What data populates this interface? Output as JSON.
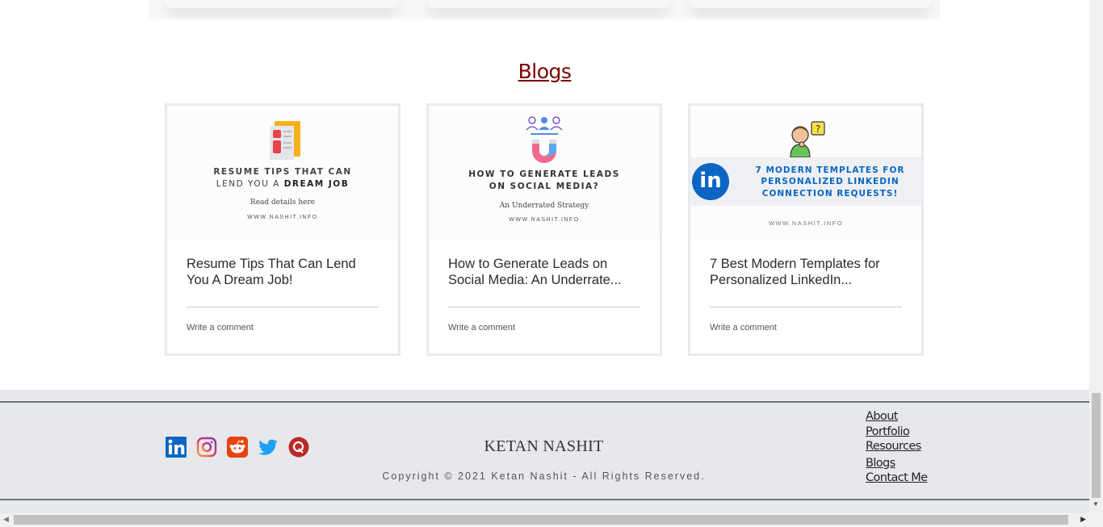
{
  "section": {
    "title": "Blogs"
  },
  "posts": [
    {
      "thumb_line1": "RESUME TIPS THAT CAN",
      "thumb_line2a": "LEND YOU A ",
      "thumb_line2b": "DREAM JOB",
      "thumb_sub": "Read details here",
      "thumb_url": "WWW.NASHIT.INFO",
      "icon": "resume-icon",
      "title": "Resume Tips That Can Lend You A Dream Job!",
      "comment": "Write a comment"
    },
    {
      "thumb_line1": "HOW TO GENERATE LEADS",
      "thumb_line2": "ON SOCIAL MEDIA?",
      "thumb_sub": "An Underrated Strategy",
      "thumb_url": "WWW.NASHIT.INFO",
      "icon": "magnet-people-icon",
      "title": "How to Generate Leads on Social Media: An Underrate...",
      "comment": "Write a comment"
    },
    {
      "thumb_line1": "7 MODERN TEMPLATES FOR",
      "thumb_line2": "PERSONALIZED LINKEDIN",
      "thumb_line3": "CONNECTION REQUESTS!",
      "thumb_url": "WWW.NASHIT.INFO",
      "icon": "thinking-person-icon",
      "title": "7 Best Modern Templates for Personalized LinkedIn...",
      "comment": "Write a comment"
    }
  ],
  "footer": {
    "brand": "KETAN NASHIT",
    "copyright": "Copyright © 2021 Ketan Nashit - All Rights Reserved.",
    "social": [
      "linkedin-icon",
      "instagram-icon",
      "reddit-icon",
      "twitter-icon",
      "quora-icon"
    ],
    "nav": [
      "About",
      "Portfolio",
      "Resources",
      "Blogs",
      "Contact Me"
    ]
  },
  "colors": {
    "title": "#7a0000",
    "footer_bg": "#e6e8eb",
    "linkedin_blue": "#0a66c2"
  }
}
